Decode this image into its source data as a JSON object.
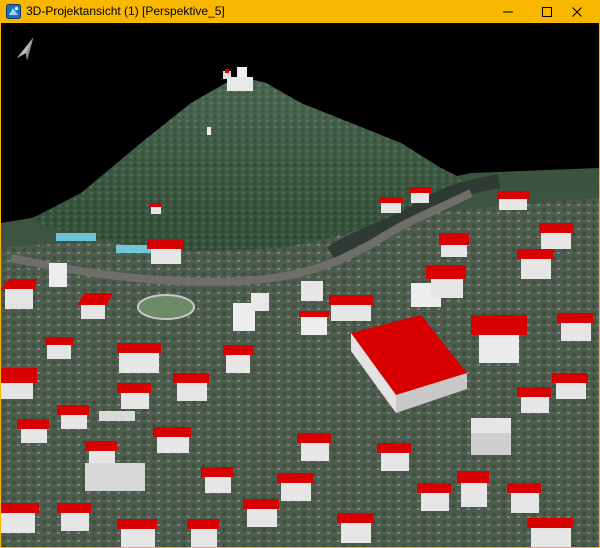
{
  "window": {
    "title": "3D-Projektansicht (1) [Perspektive_5]",
    "frame_color": "#f9b800"
  },
  "controls": {
    "minimize_icon": "minimize-icon",
    "maximize_icon": "maximize-icon",
    "close_icon": "close-icon"
  },
  "viewport": {
    "background": "#000000",
    "roof_color": "#d80000",
    "wall_color": "#e8e8e8",
    "vegetation_color": "#3c5a3a"
  },
  "overlay": {
    "compass_icon": "north-arrow-icon"
  }
}
